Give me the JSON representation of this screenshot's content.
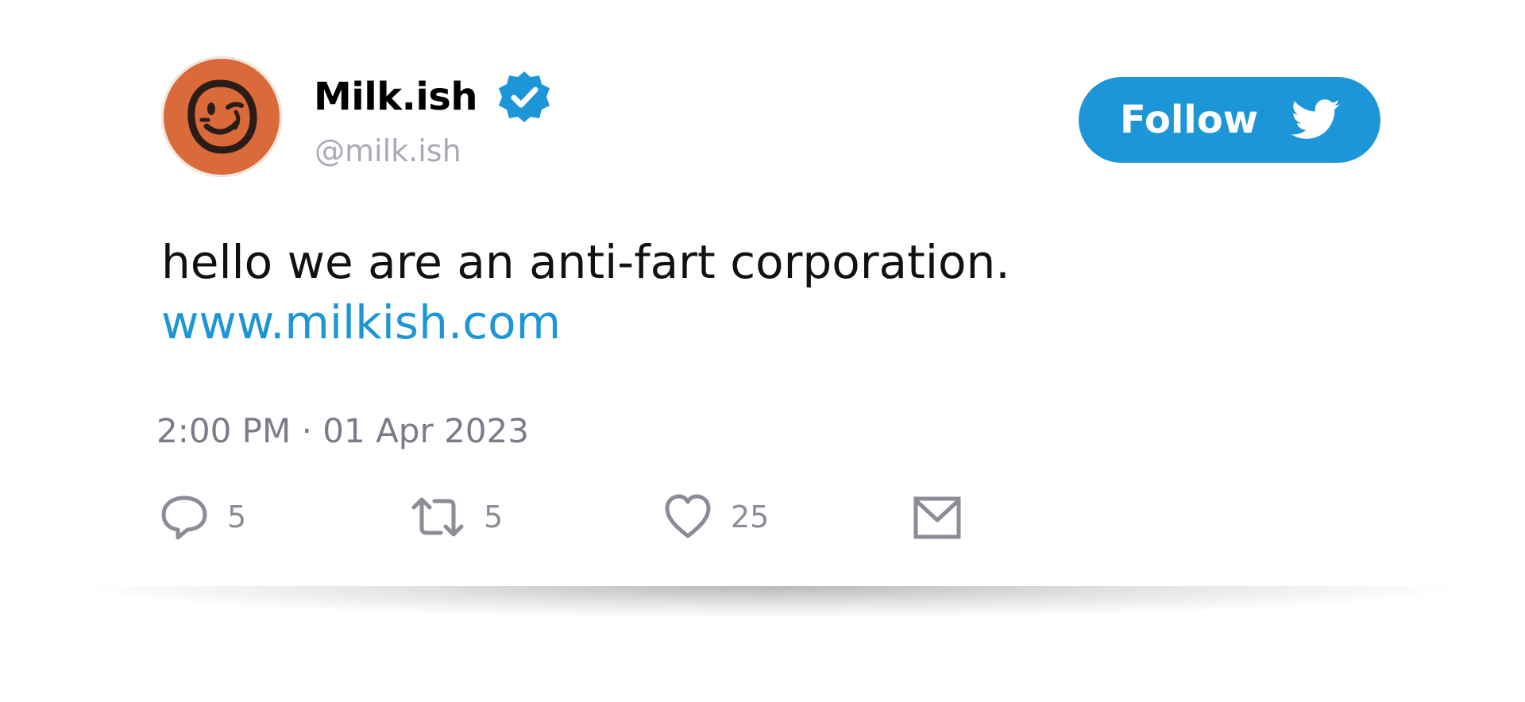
{
  "profile": {
    "display_name": "Milk.ish",
    "handle": "@milk.ish",
    "avatar_icon": "winking-face-logo-icon",
    "verified_icon": "verified-badge-icon",
    "avatar_color": "#db6a3a"
  },
  "follow_button": {
    "label": "Follow",
    "icon": "twitter-bird-icon",
    "color": "#1d96d8"
  },
  "tweet": {
    "text": "hello we are an anti-fart corporation.",
    "link": "www.milkish.com",
    "timestamp": "2:00 PM · 01 Apr 2023"
  },
  "actions": {
    "reply": {
      "icon": "reply-icon",
      "count": "5"
    },
    "retweet": {
      "icon": "retweet-icon",
      "count": "5"
    },
    "like": {
      "icon": "heart-icon",
      "count": "25"
    },
    "share": {
      "icon": "envelope-icon"
    }
  }
}
